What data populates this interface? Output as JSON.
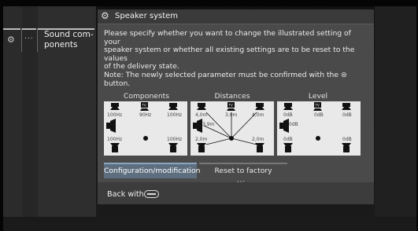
{
  "breadcrumb": {
    "gear_icon": "gear-icon",
    "more_label": "...",
    "current_label": "Sound com- ponents"
  },
  "dialog": {
    "title": "Speaker system",
    "icon": "speaker-settings-icon",
    "text_lines": [
      "Please specify whether you want to change the illustrated setting of your",
      "speaker system or whether all existing settings are to be reset to the values",
      "of the delivery state.",
      "Note: The newly selected parameter must be confirmed with the ⊜",
      "button."
    ],
    "sections": {
      "components": {
        "label": "Components",
        "values": {
          "front_left": "100Hz",
          "center": "90Hz",
          "front_right": "100Hz",
          "rear_left": "100Hz",
          "rear_right": "100Hz",
          "tv": "TV"
        }
      },
      "distances": {
        "label": "Distances",
        "values": {
          "front_left": "4,0m",
          "center": "3,0m",
          "front_right": "4,0m",
          "subwoofer": "3,9m",
          "rear_left": "2,0m",
          "rear_right": "2,0m",
          "tv": "TV"
        }
      },
      "level": {
        "label": "Level",
        "values": {
          "front_left": "0dB",
          "center": "0dB",
          "front_right": "0dB",
          "subwoofer": "0dB",
          "rear_left": "0dB",
          "rear_right": "0dB",
          "tv": "TV"
        }
      }
    },
    "tabs": {
      "active": "Configuration/modification",
      "other": "Reset to factory settings"
    },
    "footer": {
      "back_label": "Back with",
      "back_icon": "back-button-icon"
    }
  },
  "colors": {
    "dialog_bg": "#4a4a4a",
    "tab_active": "#5d6e7f",
    "diagram_bg": "#e9e9e9"
  }
}
